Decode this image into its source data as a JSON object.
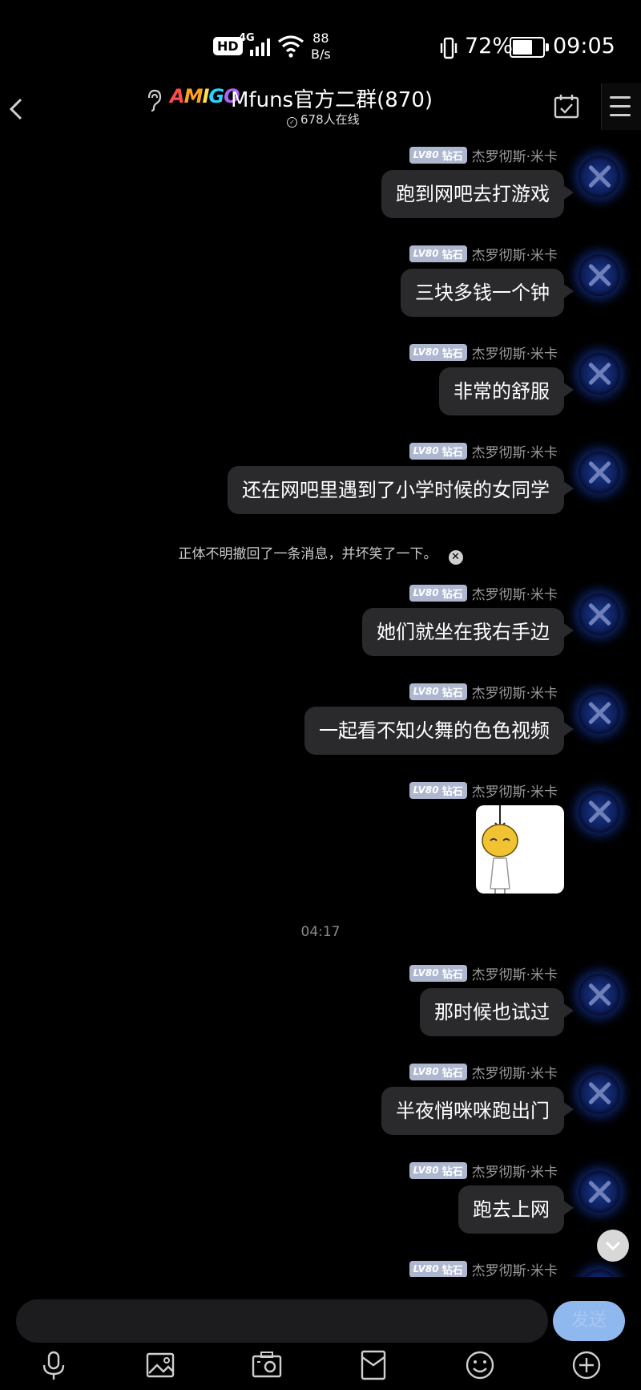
{
  "status_bar": {
    "hd": "HD",
    "network": "4G",
    "speed_value": "88",
    "speed_unit": "B/s",
    "battery_pct": "72%",
    "battery_level": 0.72,
    "time": "09:05"
  },
  "header": {
    "logo_text": [
      "A",
      "M",
      "I",
      "G",
      "O"
    ],
    "title": "Mfuns官方二群(870)",
    "online": "678人在线"
  },
  "sender": {
    "level": "LV80",
    "rank": "钻石",
    "name": "杰罗彻斯·米卡"
  },
  "messages": [
    {
      "type": "text",
      "text": "跑到网吧去打游戏"
    },
    {
      "type": "text",
      "text": "三块多钱一个钟"
    },
    {
      "type": "text",
      "text": "非常的舒服"
    },
    {
      "type": "text",
      "text": "还在网吧里遇到了小学时候的女同学"
    },
    {
      "type": "system",
      "text": "正体不明撤回了一条消息，并坏笑了一下。"
    },
    {
      "type": "text",
      "text": "她们就坐在我右手边"
    },
    {
      "type": "text",
      "text": "一起看不知火舞的色色视频"
    },
    {
      "type": "sticker",
      "icon": "hanged-doll-sticker"
    },
    {
      "type": "time",
      "text": "04:17"
    },
    {
      "type": "text",
      "text": "那时候也试过"
    },
    {
      "type": "text",
      "text": "半夜悄咪咪跑出门"
    },
    {
      "type": "text",
      "text": "跑去上网"
    }
  ],
  "input": {
    "placeholder": "",
    "send_label": "发送"
  },
  "toolbar_icons": [
    "microphone-icon",
    "image-icon",
    "camera-icon",
    "red-packet-icon",
    "emoji-icon",
    "plus-icon"
  ],
  "colors": {
    "bubble": "#2a2a2d",
    "badge": "#aeb7d0",
    "send_button": "#8fb8ee",
    "background": "#000000"
  }
}
